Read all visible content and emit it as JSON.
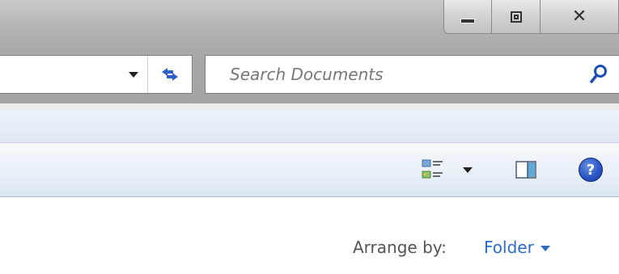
{
  "window": {
    "caption_buttons": [
      {
        "name": "minimize",
        "icon": "minimize-icon"
      },
      {
        "name": "maximize",
        "icon": "restore-icon"
      },
      {
        "name": "close",
        "icon": "close-icon"
      }
    ]
  },
  "navigation": {
    "address_dropdown_icon": "chevron-down-icon",
    "refresh_icon": "refresh-icon",
    "search": {
      "placeholder": "Search Documents",
      "icon": "search-icon"
    }
  },
  "toolbar": {
    "views_icon": "views-icon",
    "views_dropdown_icon": "chevron-down-icon",
    "preview_pane_icon": "preview-pane-icon",
    "help_icon": "help-icon",
    "help_glyph": "?"
  },
  "content": {
    "arrange_by_label": "Arrange by:",
    "arrange_by_value": "Folder"
  },
  "colors": {
    "accent": "#2e6bc4",
    "help": "#2a57c4"
  }
}
